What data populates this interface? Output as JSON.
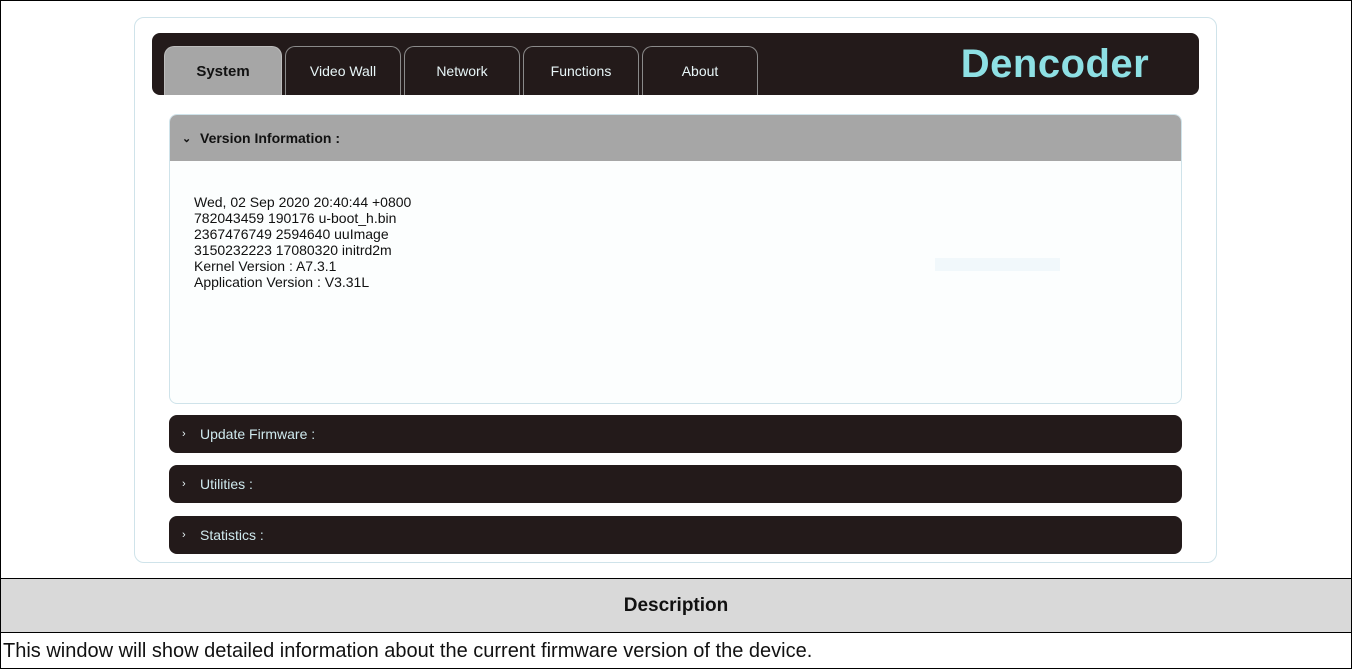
{
  "app": {
    "brand": "Dencoder",
    "tabs": [
      {
        "label": "System",
        "active": true
      },
      {
        "label": "Video Wall",
        "active": false
      },
      {
        "label": "Network",
        "active": false
      },
      {
        "label": "Functions",
        "active": false
      },
      {
        "label": "About",
        "active": false
      }
    ],
    "sections": {
      "version": {
        "title": "Version Information :",
        "lines": [
          "Wed, 02 Sep 2020 20:40:44 +0800",
          "782043459 190176 u-boot_h.bin",
          "2367476749 2594640 uuImage",
          "3150232223 17080320 initrd2m",
          "Kernel Version : A7.3.1",
          "Application Version : V3.31L"
        ]
      },
      "update_firmware": {
        "title": "Update Firmware :"
      },
      "utilities": {
        "title": "Utilities :"
      },
      "statistics": {
        "title": "Statistics :"
      }
    },
    "icons": {
      "expanded": "chevron-down-icon",
      "collapsed": "chevron-right-icon"
    },
    "colors": {
      "bar": "#231a1a",
      "active_tab": "#a6a6a6",
      "brand": "#8ee0e4"
    }
  },
  "doc": {
    "description_header": "Description",
    "description_text": "This window will show detailed information about the current firmware version of the device."
  }
}
